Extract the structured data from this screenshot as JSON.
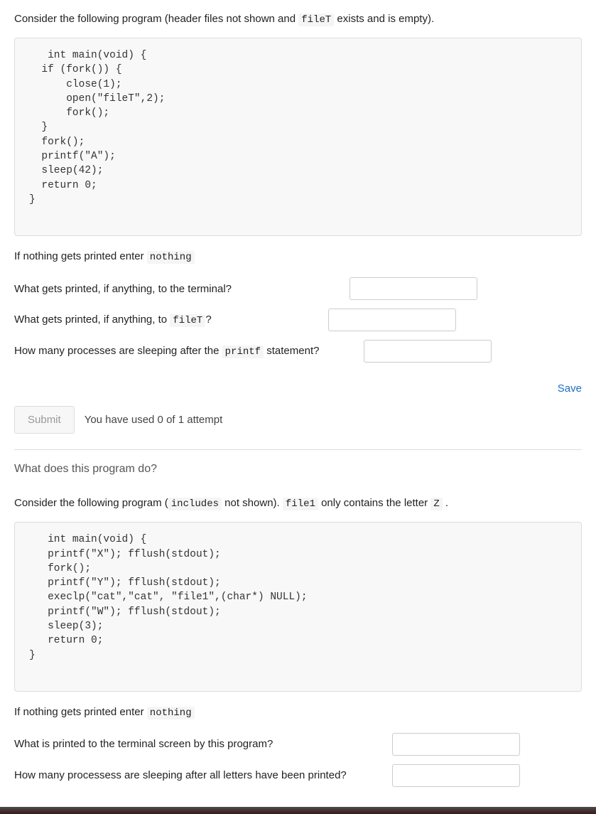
{
  "q1": {
    "intro_prefix": "Consider the following program (header files not shown and ",
    "intro_code": "fileT",
    "intro_suffix": " exists and is empty).",
    "code": "   int main(void) {\n  if (fork()) {\n      close(1);\n      open(\"fileT\",2);\n      fork();\n  }\n  fork();\n  printf(\"A\");\n  sleep(42);\n  return 0;\n}",
    "hint_prefix": "If nothing gets printed enter ",
    "hint_code": "nothing",
    "question1": "What gets printed, if anything, to the terminal?",
    "question2_prefix": "What gets printed, if anything, to ",
    "question2_code": "fileT",
    "question2_suffix": "?",
    "question3_prefix": "How many processes are sleeping after the ",
    "question3_code": "printf",
    "question3_suffix": " statement?"
  },
  "save_label": "Save",
  "submit_label": "Submit",
  "attempt_text": "You have used 0 of 1 attempt",
  "section2_heading": "What does this program do?",
  "q2": {
    "intro_p1": "Consider the following program (",
    "intro_code1": "includes",
    "intro_p2": " not shown). ",
    "intro_code2": "file1",
    "intro_p3": " only contains the letter ",
    "intro_code3": "Z",
    "intro_p4": " .",
    "code": "   int main(void) {\n   printf(\"X\"); fflush(stdout);\n   fork();\n   printf(\"Y\"); fflush(stdout);\n   execlp(\"cat\",\"cat\", \"file1\",(char*) NULL);\n   printf(\"W\"); fflush(stdout);\n   sleep(3);\n   return 0;\n}",
    "hint_prefix": "If nothing gets printed enter ",
    "hint_code": "nothing",
    "question1": "What is printed to the terminal screen by this program?",
    "question2": "How many processess are sleeping after all letters have been printed?"
  }
}
